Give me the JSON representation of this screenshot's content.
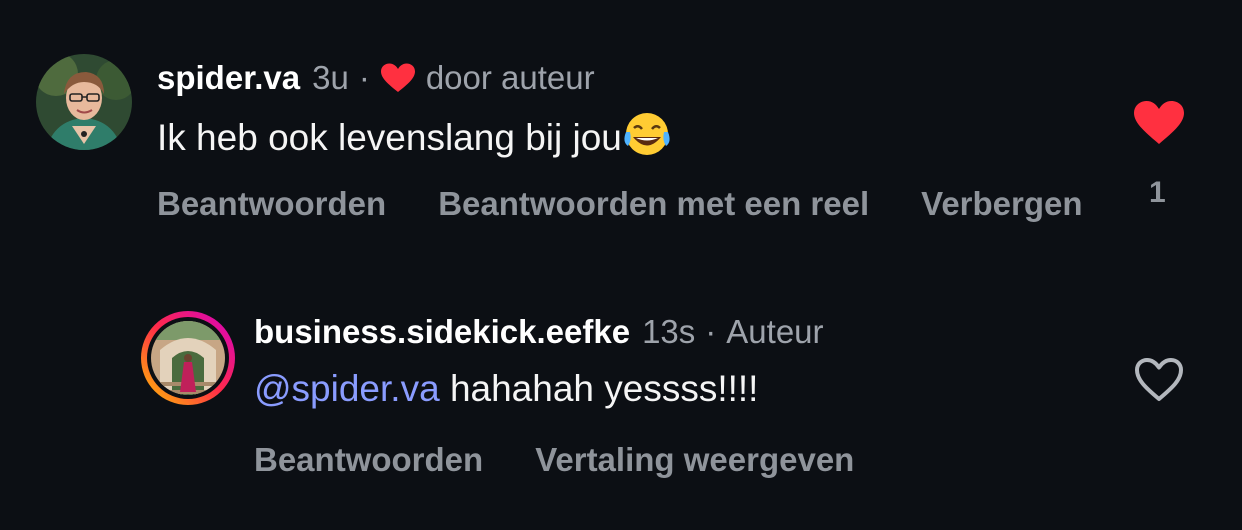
{
  "comments": [
    {
      "username": "spider.va",
      "time": "3u",
      "liked_by_author_label": "door auteur",
      "text": "Ik heb ook levenslang bij jou",
      "emoji": "face-with-tears-of-joy",
      "actions": [
        "Beantwoorden",
        "Beantwoorden met een reel",
        "Verbergen"
      ],
      "like_count": "1",
      "liked": true
    },
    {
      "username": "business.sidekick.eefke",
      "time": "13s",
      "role_label": "Auteur",
      "mention": "@spider.va",
      "text": "hahahah yessss!!!!",
      "actions": [
        "Beantwoorden",
        "Vertaling weergeven"
      ],
      "liked": false
    }
  ],
  "colors": {
    "background": "#0c0f14",
    "heart_red": "#ff3040",
    "mention": "#8a9cff",
    "muted": "#8f949b"
  }
}
